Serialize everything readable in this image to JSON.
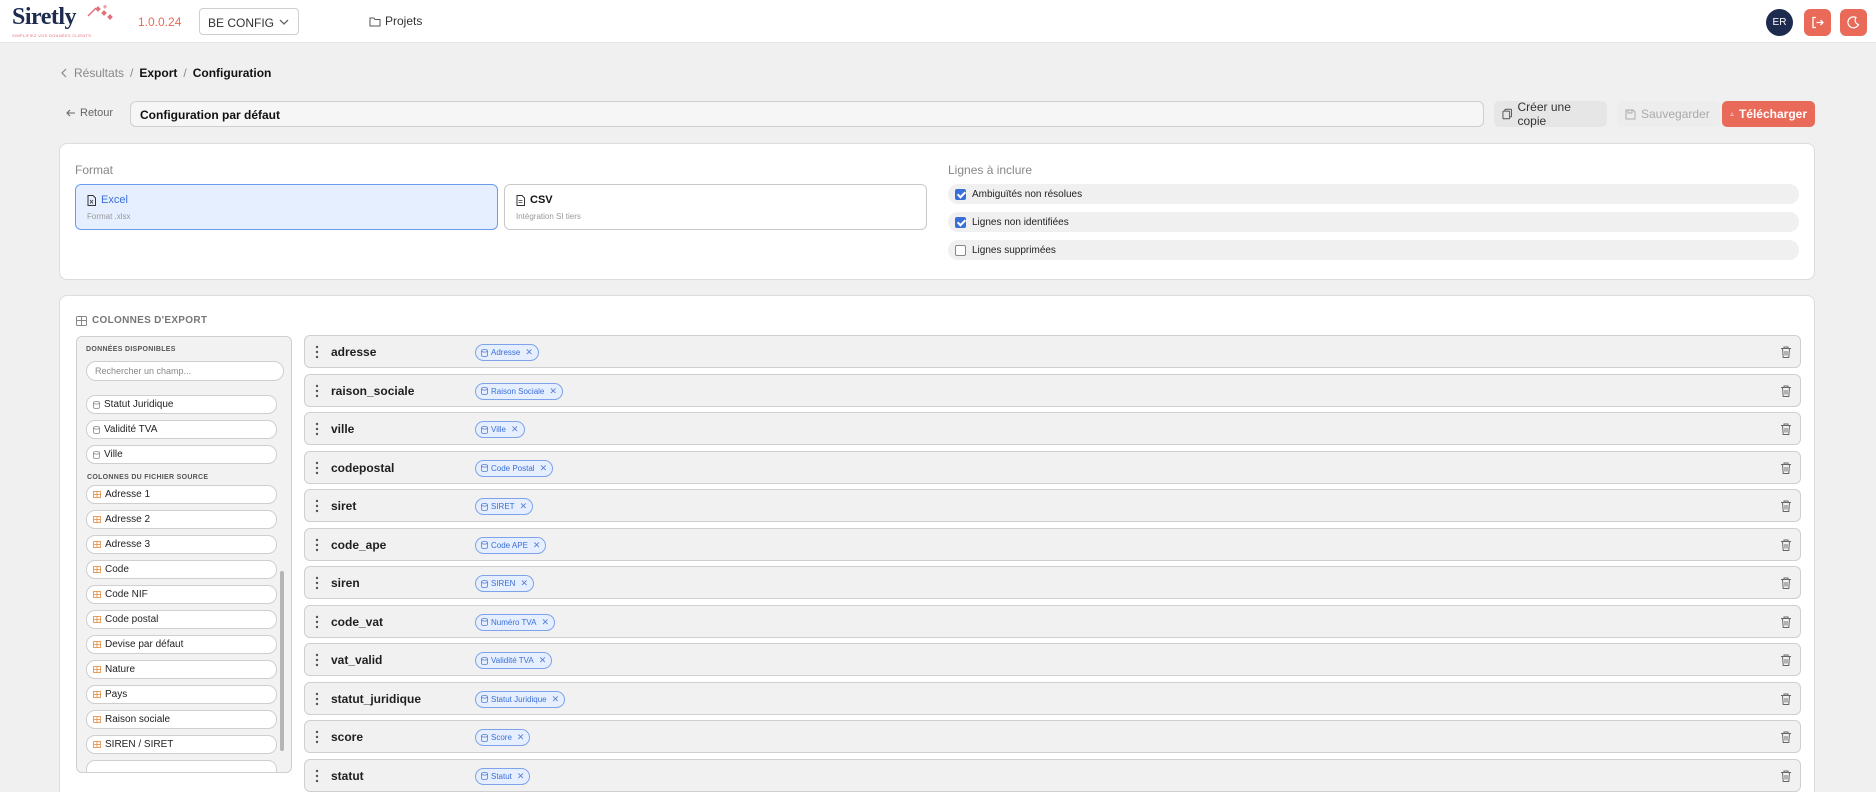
{
  "app": {
    "brand": "Siretly",
    "tagline": "SIMPLIFIEZ VOS DONNÉES CLIENTS",
    "version": "1.0.0.24",
    "environment": "BE CONFIG",
    "nav_projects": "Projets",
    "user_initials": "ER"
  },
  "breadcrumb": [
    "Résultats",
    "Export",
    "Configuration"
  ],
  "toolbar": {
    "back_label": "Retour",
    "config_name": "Configuration par défaut",
    "copy_label": "Créer une copie",
    "save_label": "Sauvegarder",
    "download_label": "Télécharger"
  },
  "format": {
    "label": "Format",
    "options": [
      {
        "title": "Excel",
        "subtitle": "Format .xlsx",
        "selected": true
      },
      {
        "title": "CSV",
        "subtitle": "Intégration SI tiers",
        "selected": false
      }
    ]
  },
  "lines": {
    "label": "Lignes à inclure",
    "items": [
      {
        "label": "Ambiguïtés non résolues",
        "checked": true
      },
      {
        "label": "Lignes non identifiées",
        "checked": true
      },
      {
        "label": "Lignes supprimées",
        "checked": false
      }
    ]
  },
  "columns": {
    "title": "COLONNES D'EXPORT",
    "available_label": "DONNÉES DISPONIBLES",
    "search_placeholder": "Rechercher un champ...",
    "available_fields": [
      "Statut Juridique",
      "Validité TVA",
      "Ville"
    ],
    "source_label": "COLONNES DU FICHIER SOURCE",
    "source_fields": [
      "Adresse 1",
      "Adresse 2",
      "Adresse 3",
      "Code",
      "Code NIF",
      "Code postal",
      "Devise par défaut",
      "Nature",
      "Pays",
      "Raison sociale",
      "SIREN / SIRET"
    ],
    "mappings": [
      {
        "name": "adresse",
        "tag": "Adresse"
      },
      {
        "name": "raison_sociale",
        "tag": "Raison Sociale"
      },
      {
        "name": "ville",
        "tag": "Ville"
      },
      {
        "name": "codepostal",
        "tag": "Code Postal"
      },
      {
        "name": "siret",
        "tag": "SIRET"
      },
      {
        "name": "code_ape",
        "tag": "Code APE"
      },
      {
        "name": "siren",
        "tag": "SIREN"
      },
      {
        "name": "code_vat",
        "tag": "Numéro TVA"
      },
      {
        "name": "vat_valid",
        "tag": "Validité TVA"
      },
      {
        "name": "statut_juridique",
        "tag": "Statut Juridique"
      },
      {
        "name": "score",
        "tag": "Score"
      },
      {
        "name": "statut",
        "tag": "Statut"
      }
    ]
  },
  "colors": {
    "accent": "#ea6a5a",
    "selection_blue": "#3b6fd8",
    "brand_navy": "#1d2b4f"
  }
}
